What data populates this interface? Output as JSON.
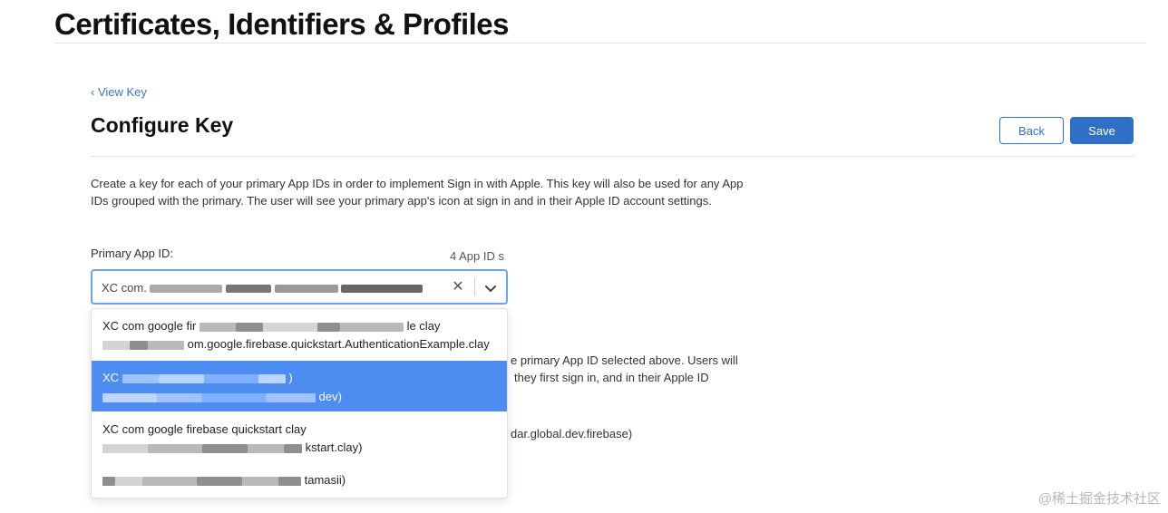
{
  "header": {
    "title": "Certificates, Identifiers & Profiles"
  },
  "nav": {
    "back_link": "‹ View Key"
  },
  "page": {
    "title": "Configure Key"
  },
  "actions": {
    "back_label": "Back",
    "save_label": "Save"
  },
  "description": "Create a key for each of your primary App IDs in order to implement Sign in with Apple. This key will also be used for any App IDs grouped with the primary. The user will see your primary app's icon at sign in and in their Apple ID account settings.",
  "primary_app_id": {
    "label": "Primary App ID:",
    "count": "4 App ID s",
    "selected_value_prefix": "XC com.",
    "clear_icon": "close-icon",
    "toggle_icon": "chevron-down-icon",
    "options": [
      {
        "line1_prefix": "XC com google fir",
        "line1_suffix": "le clay",
        "line2_suffix": "om.google.firebase.quickstart.AuthenticationExample.clay",
        "selected": false
      },
      {
        "line1_prefix": "XC",
        "line1_suffix": ")",
        "line2_suffix": "dev)",
        "selected": true
      },
      {
        "line1_prefix": "XC com google firebase quickstart clay",
        "line1_suffix": "",
        "line2_suffix": "kstart.clay)",
        "selected": false
      },
      {
        "line1_prefix": "",
        "line1_suffix": "",
        "line2_suffix": "tamasii)",
        "selected": false
      }
    ]
  },
  "background_text": {
    "line_a": "e primary App ID selected above. Users will",
    "line_b": "they first sign in, and in their Apple ID",
    "line_c": "dar.global.dev.firebase)"
  },
  "watermark": "@稀土掘金技术社区",
  "colors": {
    "accent": "#2f6fc6",
    "selected_option": "#4d8cf0",
    "focus_border": "#6aa2f2"
  }
}
